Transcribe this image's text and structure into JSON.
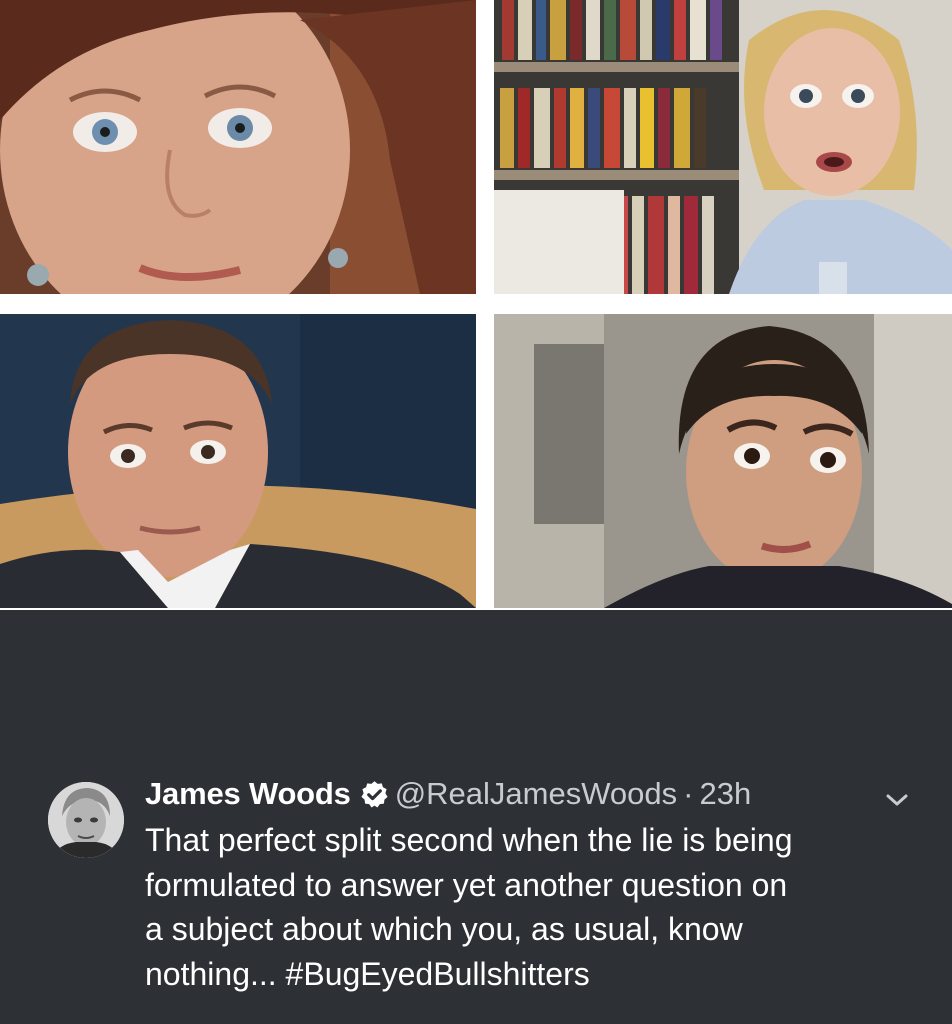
{
  "photo_grid": {
    "tiles": [
      {
        "description_icon": "wide-eyed-face-photo"
      },
      {
        "description_icon": "wide-eyed-face-photo"
      },
      {
        "description_icon": "wide-eyed-face-photo"
      },
      {
        "description_icon": "wide-eyed-face-photo"
      }
    ]
  },
  "tweet": {
    "author": {
      "display_name": "James Woods",
      "handle": "@RealJamesWoods",
      "verified_icon": "verified-badge-icon",
      "avatar_icon": "profile-avatar"
    },
    "separator": "·",
    "timestamp": "23h",
    "menu_icon": "chevron-down-icon",
    "text_lines": [
      "That perfect split second when the lie is being",
      "formulated to answer yet another question on",
      "a subject about which you, as usual, know",
      "nothing..."
    ],
    "hashtag": "#BugEyedBullshitters",
    "colors": {
      "background": "#2d3035",
      "primary_text": "#ffffff",
      "secondary_text": "#c8cbd0"
    }
  }
}
